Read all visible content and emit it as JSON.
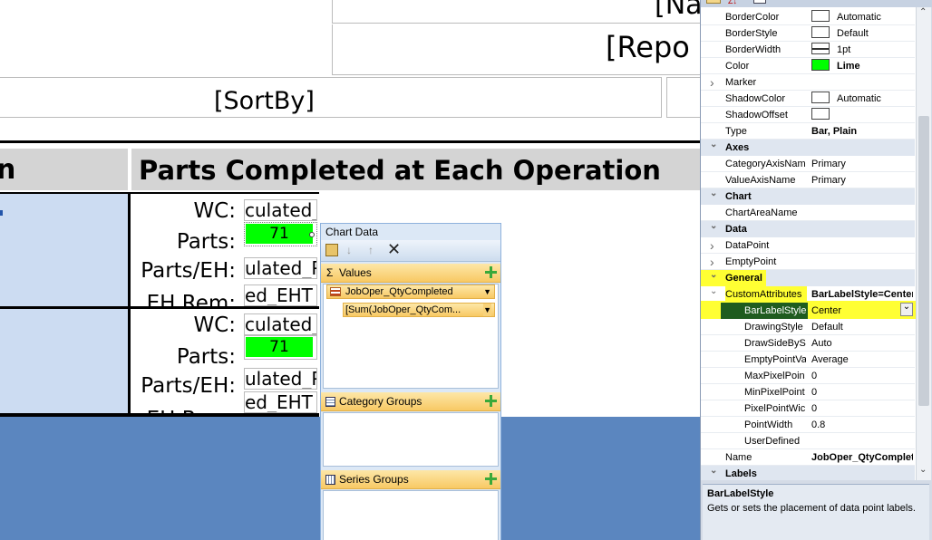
{
  "report": {
    "name_placeholder": "[Na",
    "report_placeholder": "[Repo",
    "sortby_placeholder": "[SortBy]",
    "left_header_fragment": "n",
    "section_title": "Parts Completed at Each Operation",
    "rows": [
      {
        "wc_label": "WC:",
        "wc_value": "culated_",
        "parts_label": "Parts:",
        "parts_value": "71",
        "parts_eh_label": "Parts/EH:",
        "parts_eh_value": "ulated_P",
        "eh_rem_label": "EH Rem:",
        "eh_rem_value": "ed_EHT"
      },
      {
        "wc_label": "WC:",
        "wc_value": "culated_",
        "parts_label": "Parts:",
        "parts_value": "71",
        "parts_eh_label": "Parts/EH:",
        "parts_eh_value": "ulated_P",
        "eh_rem_label": "EH Rem:",
        "eh_rem_value": "ed_EHT"
      }
    ]
  },
  "chart_data_panel": {
    "title": "Chart Data",
    "values_label": "Values",
    "value_field": "JobOper_QtyCompleted",
    "value_expr": "[Sum(JobOper_QtyCom...",
    "category_groups_label": "Category Groups",
    "series_groups_label": "Series Groups"
  },
  "properties": {
    "rows": [
      {
        "kind": "prop",
        "name": "BorderColor",
        "value": "Automatic",
        "swatch": "#ffffff"
      },
      {
        "kind": "prop",
        "name": "BorderStyle",
        "value": "Default",
        "swatch": "#ffffff"
      },
      {
        "kind": "prop",
        "name": "BorderWidth",
        "value": "1pt",
        "swatch": "line"
      },
      {
        "kind": "prop",
        "name": "Color",
        "value": "Lime",
        "swatch": "#00ff00",
        "bold": true
      },
      {
        "kind": "prop",
        "name": "Marker",
        "value": "",
        "expand": ">"
      },
      {
        "kind": "prop",
        "name": "ShadowColor",
        "value": "Automatic",
        "swatch": "#ffffff"
      },
      {
        "kind": "prop",
        "name": "ShadowOffset",
        "value": "",
        "swatch": "#ffffff"
      },
      {
        "kind": "prop",
        "name": "Type",
        "value": "Bar, Plain",
        "bold": true
      },
      {
        "kind": "cat",
        "name": "Axes"
      },
      {
        "kind": "prop",
        "name": "CategoryAxisNam",
        "value": "Primary"
      },
      {
        "kind": "prop",
        "name": "ValueAxisName",
        "value": "Primary"
      },
      {
        "kind": "cat",
        "name": "Chart"
      },
      {
        "kind": "prop",
        "name": "ChartAreaName",
        "value": ""
      },
      {
        "kind": "cat",
        "name": "Data"
      },
      {
        "kind": "prop",
        "name": "DataPoint",
        "value": "",
        "expand": ">"
      },
      {
        "kind": "prop",
        "name": "EmptyPoint",
        "value": "",
        "expand": ">"
      },
      {
        "kind": "cat",
        "name": "General",
        "highlight": true
      },
      {
        "kind": "prop",
        "name": "CustomAttributes",
        "value": "BarLabelStyle=Center",
        "bold": true,
        "expand": "v",
        "highlight": true
      },
      {
        "kind": "sub",
        "name": "BarLabelStyle",
        "value": "Center",
        "selected": true
      },
      {
        "kind": "sub",
        "name": "DrawingStyle",
        "value": "Default"
      },
      {
        "kind": "sub",
        "name": "DrawSideBySi",
        "value": "Auto"
      },
      {
        "kind": "sub",
        "name": "EmptyPointVa",
        "value": "Average"
      },
      {
        "kind": "sub",
        "name": "MaxPixelPoin",
        "value": "0"
      },
      {
        "kind": "sub",
        "name": "MinPixelPoint",
        "value": "0"
      },
      {
        "kind": "sub",
        "name": "PixelPointWic",
        "value": "0"
      },
      {
        "kind": "sub",
        "name": "PointWidth",
        "value": "0.8"
      },
      {
        "kind": "sub",
        "name": "UserDefined",
        "value": ""
      },
      {
        "kind": "prop",
        "name": "Name",
        "value": "JobOper_QtyComplet",
        "bold": true
      },
      {
        "kind": "cat",
        "name": "Labels"
      }
    ],
    "description_title": "BarLabelStyle",
    "description_text": "Gets or sets the placement of data point labels."
  },
  "colors": {
    "lime": "#00ff00",
    "highlight_yellow": "#ffff33",
    "selected_row": "#1f5c1f",
    "design_background": "#5b86bf"
  }
}
